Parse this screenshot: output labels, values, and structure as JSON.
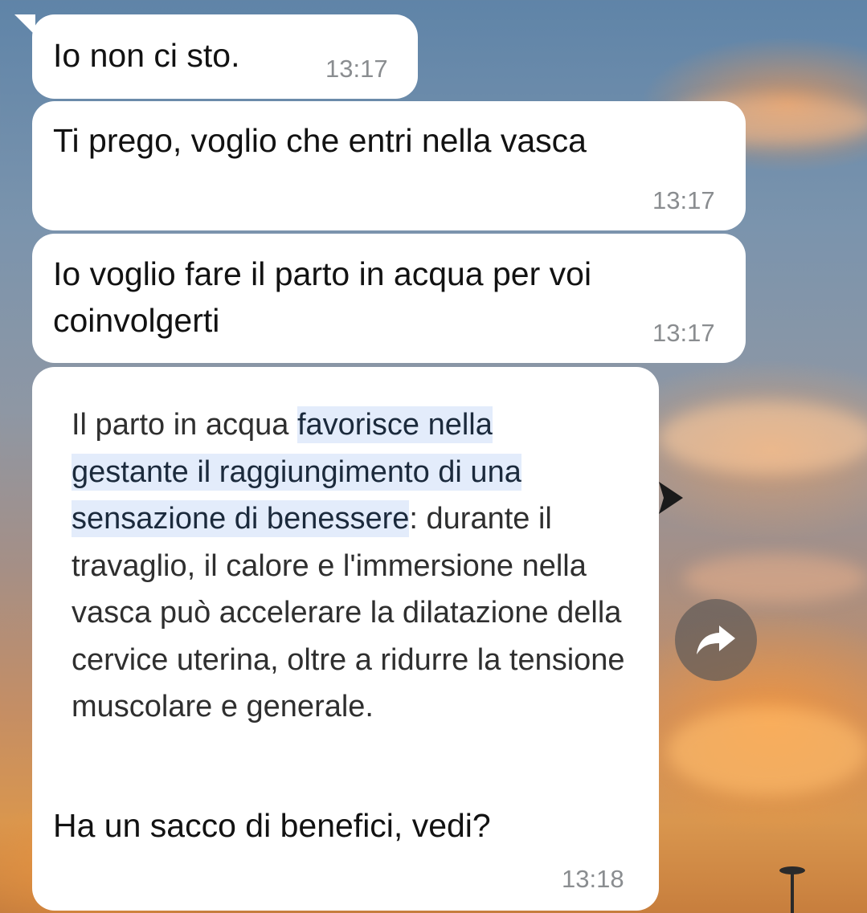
{
  "messages": [
    {
      "text": "Io non ci sto.",
      "time": "13:17"
    },
    {
      "text": "Ti prego, voglio che entri nella vasca",
      "time": "13:17"
    },
    {
      "text": "Io voglio fare il parto in acqua per voi coinvolgerti",
      "time": "13:17"
    }
  ],
  "quoted": {
    "before": "Il parto in acqua ",
    "highlight_1": "favorisce nella",
    "highlight_2": "gestante il raggiungimento di una",
    "highlight_3": "sensazione di benessere",
    "after": ": durante il travaglio, il calore e l'immersione nella vasca può accelerare la dilatazione della cervice uterina, oltre a ridurre la tensione muscolare e generale."
  },
  "last_message": {
    "text": "Ha un sacco di benefici, vedi?",
    "time": "13:18"
  },
  "icons": {
    "forward": "forward-arrow-icon"
  },
  "colors": {
    "bubble": "#ffffff",
    "highlight": "#e3ecfb",
    "time": "#8a8d90"
  }
}
